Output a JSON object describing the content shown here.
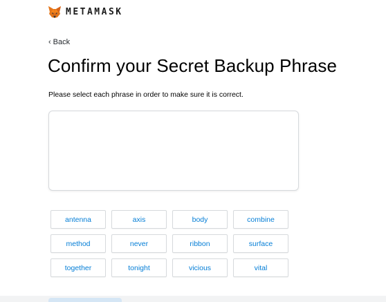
{
  "header": {
    "logo_text": "METAMASK",
    "logo_icon": "fox-icon"
  },
  "nav": {
    "back_label": "Back",
    "back_icon": "chevron-left-icon"
  },
  "main": {
    "title": "Confirm your Secret Backup Phrase",
    "instructions": "Please select each phrase in order to make sure it is correct.",
    "words": [
      "antenna",
      "axis",
      "body",
      "combine",
      "method",
      "never",
      "ribbon",
      "surface",
      "together",
      "tonight",
      "vicious",
      "vital"
    ]
  },
  "colors": {
    "word_text": "#037dd6",
    "border": "#d6d9dc",
    "confirm_button_disabled": "#d5e6f5"
  }
}
